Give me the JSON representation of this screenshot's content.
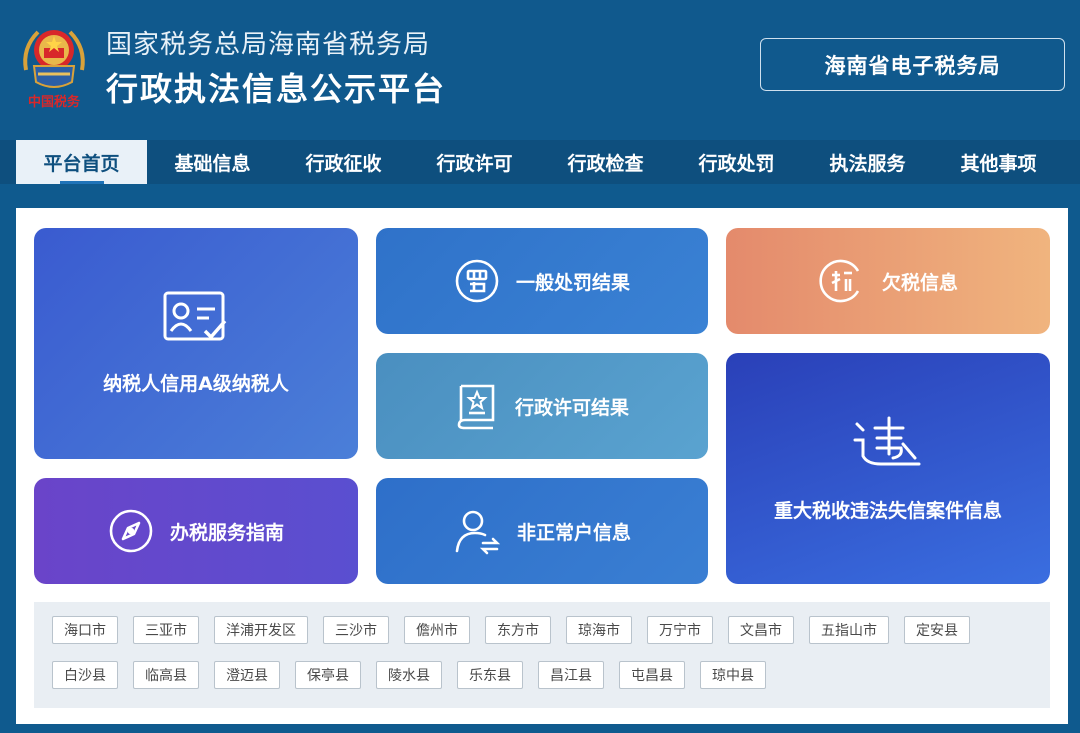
{
  "header": {
    "org_name": "国家税务总局海南省税务局",
    "platform_name": "行政执法信息公示平台",
    "emblem_caption": "中国税务",
    "etax_label": "海南省电子税务局"
  },
  "nav": {
    "items": [
      {
        "label": "平台首页",
        "active": true
      },
      {
        "label": "基础信息"
      },
      {
        "label": "行政征收"
      },
      {
        "label": "行政许可"
      },
      {
        "label": "行政检查"
      },
      {
        "label": "行政处罚"
      },
      {
        "label": "执法服务"
      },
      {
        "label": "其他事项"
      }
    ]
  },
  "tiles": {
    "credit": {
      "label": "纳税人信用A级纳税人",
      "icon": "id-card-check-icon"
    },
    "penalty": {
      "label": "一般处罚结果",
      "icon": "penalty-icon"
    },
    "arrears": {
      "label": "欠税信息",
      "icon": "tax-arrears-icon"
    },
    "permit": {
      "label": "行政许可结果",
      "icon": "permit-book-icon"
    },
    "major": {
      "label": "重大税收违法失信案件信息",
      "icon": "violation-icon"
    },
    "guide": {
      "label": "办税服务指南",
      "icon": "compass-icon"
    },
    "abnormal": {
      "label": "非正常户信息",
      "icon": "user-transfer-icon"
    }
  },
  "regions": {
    "row1": [
      "海口市",
      "三亚市",
      "洋浦开发区",
      "三沙市",
      "儋州市",
      "东方市",
      "琼海市",
      "万宁市",
      "文昌市",
      "五指山市",
      "定安县"
    ],
    "row2": [
      "白沙县",
      "临高县",
      "澄迈县",
      "保亭县",
      "陵水县",
      "乐东县",
      "昌江县",
      "屯昌县",
      "琼中县"
    ]
  },
  "colors": {
    "header_bg": "#10598d",
    "nav_bg": "#0e4f7e",
    "accent": "#1f73b8"
  }
}
